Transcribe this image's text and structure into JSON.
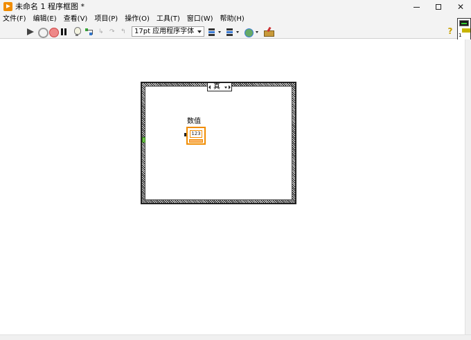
{
  "window": {
    "title": "未命名 1 程序框图 *",
    "controls": {
      "minimize": "minimize",
      "maximize": "maximize",
      "close": "✕"
    }
  },
  "menu": {
    "items": [
      {
        "label": "文件(F)"
      },
      {
        "label": "编辑(E)"
      },
      {
        "label": "查看(V)"
      },
      {
        "label": "项目(P)"
      },
      {
        "label": "操作(O)"
      },
      {
        "label": "工具(T)"
      },
      {
        "label": "窗口(W)"
      },
      {
        "label": "帮助(H)"
      }
    ]
  },
  "toolbar": {
    "font_selector": "17pt 应用程序字体",
    "step_into": "↳",
    "step_over": "↷",
    "step_out": "↰",
    "help": "?",
    "icons": [
      "run-arrow-icon",
      "run-continuously-icon",
      "abort-icon",
      "pause-icon",
      "highlight-execution-icon",
      "retain-wire-values-icon",
      "step-into-icon",
      "step-over-icon",
      "step-out-icon",
      "align-icon",
      "distribute-icon",
      "reorder-icon",
      "cleanup-diagram-icon",
      "help-icon"
    ]
  },
  "vi_icon": {
    "number": "1"
  },
  "diagram": {
    "case_structure": {
      "selector_value": "真"
    },
    "control": {
      "label": "数值",
      "terminal_text": "123",
      "color": "#f08c00"
    }
  }
}
